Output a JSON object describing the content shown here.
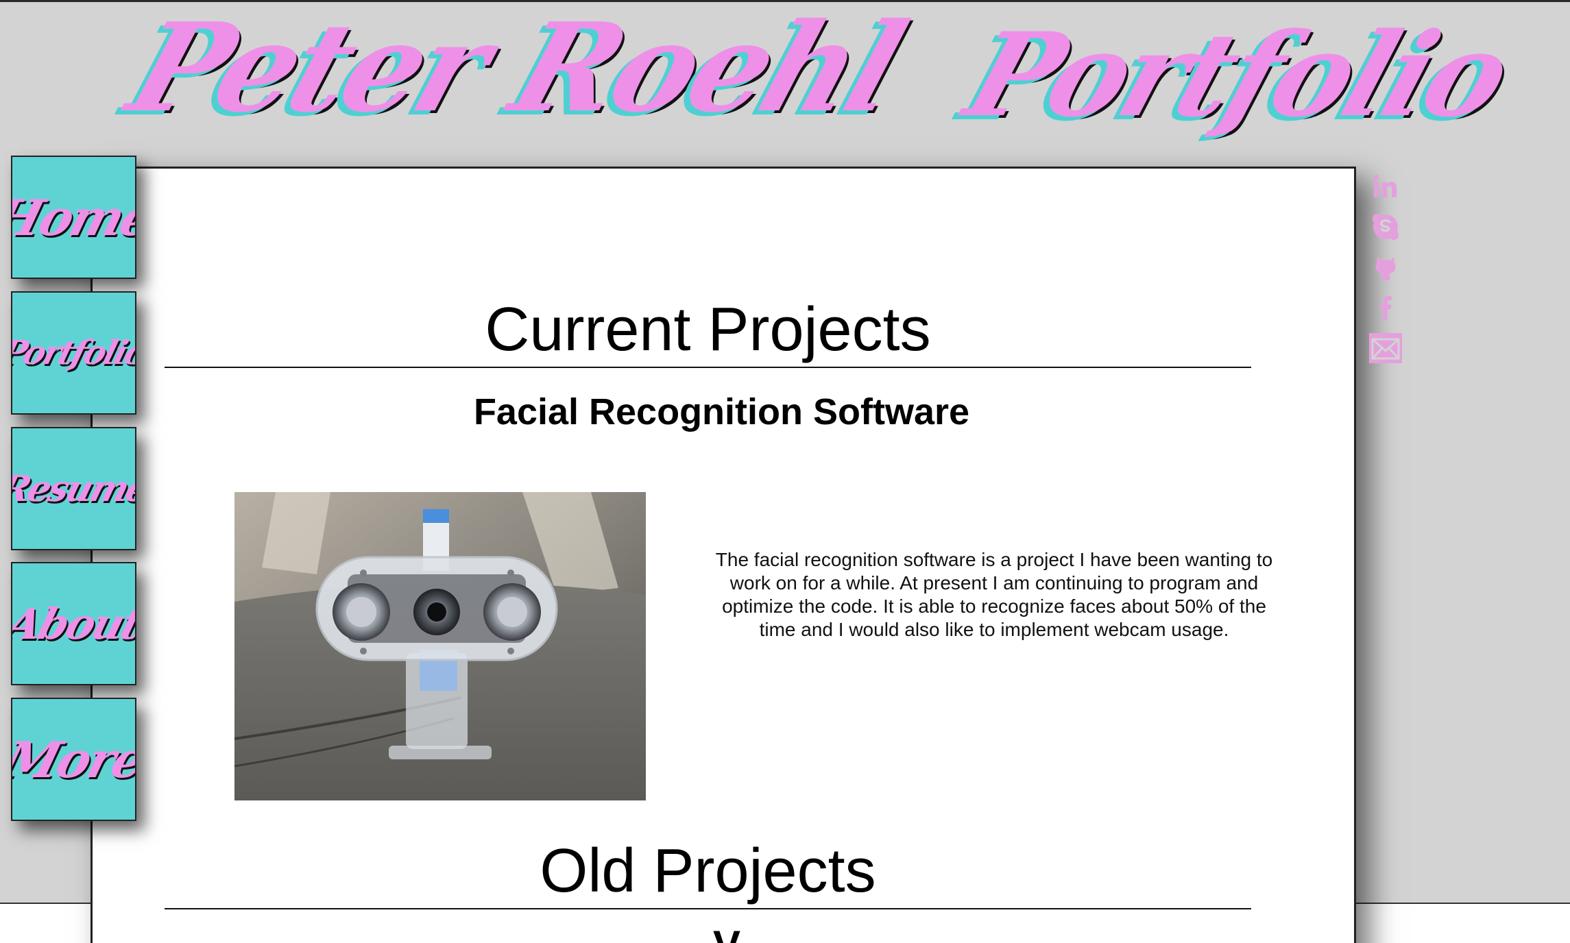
{
  "header": {
    "site_title": "Peter Roehl",
    "page_title": "Portfolio"
  },
  "nav": {
    "items": [
      {
        "label": "Home"
      },
      {
        "label": "Portfolio"
      },
      {
        "label": "Resume"
      },
      {
        "label": "About"
      },
      {
        "label": "More"
      }
    ]
  },
  "social": {
    "icons": [
      "linkedin-icon",
      "skype-icon",
      "github-icon",
      "facebook-icon",
      "email-icon"
    ]
  },
  "main": {
    "current_heading": "Current Projects",
    "project": {
      "title": "Facial Recognition Software",
      "description": "The facial recognition software is a project I have been wanting to work on for a while. At present I am continuing to program and optimize the code. It is able to recognize faces about 50% of the time and I would also like to implement webcam usage."
    },
    "old_heading": "Old Projects",
    "next_partial": "V"
  },
  "colors": {
    "background": "#d3d3d3",
    "card": "#ffffff",
    "accent_pink": "#ee90e8",
    "accent_teal": "#5fd3d4",
    "social_icon": "#e4a0dd"
  }
}
